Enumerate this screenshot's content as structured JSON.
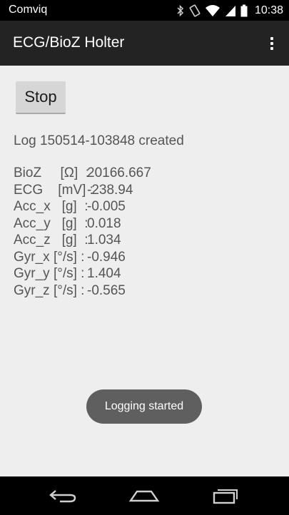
{
  "status_bar": {
    "carrier": "Comviq",
    "time": "10:38",
    "icons": [
      "bluetooth-icon",
      "rotation-icon",
      "wifi-icon",
      "signal-icon",
      "battery-icon"
    ]
  },
  "action_bar": {
    "title": "ECG/BioZ Holter",
    "overflow_icon": "overflow-menu-icon"
  },
  "main": {
    "stop_button_label": "Stop",
    "log_message": "Log 150514-103848 created",
    "readings": [
      {
        "label": "BioZ     [Ω]  : ",
        "value": "20166.667"
      },
      {
        "label": "ECG    [mV] : ",
        "value": "-238.94"
      },
      {
        "label": "Acc_x   [g]  : ",
        "value": "-0.005"
      },
      {
        "label": "Acc_y   [g]  : ",
        "value": "0.018"
      },
      {
        "label": "Acc_z   [g]  : ",
        "value": "1.034"
      },
      {
        "label": "Gyr_x [°/s] : ",
        "value": "-0.946"
      },
      {
        "label": "Gyr_y [°/s] : ",
        "value": "1.404"
      },
      {
        "label": "Gyr_z [°/s] : ",
        "value": "-0.565"
      }
    ]
  },
  "toast": {
    "text": "Logging started"
  },
  "nav_bar": {
    "buttons": [
      "back-icon",
      "home-icon",
      "recents-icon"
    ]
  },
  "colors": {
    "status_bar_bg": "#000000",
    "action_bar_bg": "#232323",
    "content_bg": "#eeeeee",
    "text_gray": "#555555",
    "toast_bg": "#5f5f5f"
  }
}
